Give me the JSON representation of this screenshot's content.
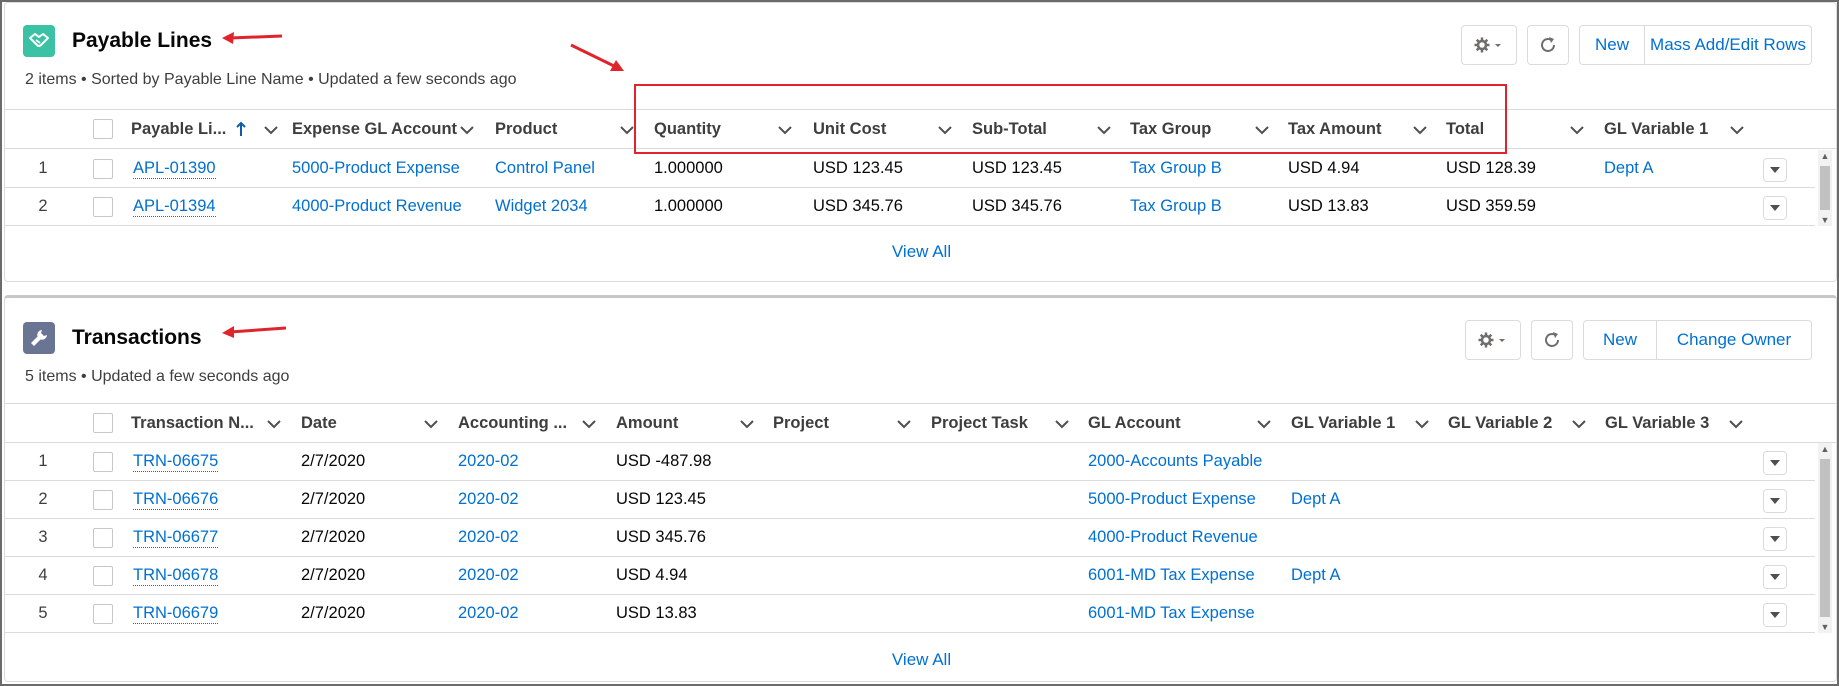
{
  "payable": {
    "title": "Payable Lines",
    "subtitle": "2 items • Sorted by Payable Line Name • Updated a few seconds ago",
    "buttons": {
      "new": "New",
      "mass": "Mass Add/Edit Rows"
    },
    "columns": [
      "Payable Li...",
      "Expense GL Account",
      "Product",
      "Quantity",
      "Unit Cost",
      "Sub-Total",
      "Tax Group",
      "Tax Amount",
      "Total",
      "GL Variable 1"
    ],
    "rows": [
      {
        "num": "1",
        "name": "APL-01390",
        "gl": "5000-Product Expense",
        "product": "Control Panel",
        "qty": "1.000000",
        "unit": "USD 123.45",
        "sub": "USD 123.45",
        "taxgroup": "Tax Group B",
        "taxamt": "USD 4.94",
        "total": "USD 128.39",
        "glv1": "Dept A"
      },
      {
        "num": "2",
        "name": "APL-01394",
        "gl": "4000-Product Revenue",
        "product": "Widget 2034",
        "qty": "1.000000",
        "unit": "USD 345.76",
        "sub": "USD 345.76",
        "taxgroup": "Tax Group B",
        "taxamt": "USD 13.83",
        "total": "USD 359.59",
        "glv1": ""
      }
    ],
    "view_all": "View All"
  },
  "transactions": {
    "title": "Transactions",
    "subtitle": "5 items • Updated a few seconds ago",
    "buttons": {
      "new": "New",
      "owner": "Change Owner"
    },
    "columns": [
      "Transaction N...",
      "Date",
      "Accounting ...",
      "Amount",
      "Project",
      "Project Task",
      "GL Account",
      "GL Variable 1",
      "GL Variable 2",
      "GL Variable 3"
    ],
    "rows": [
      {
        "num": "1",
        "name": "TRN-06675",
        "date": "2/7/2020",
        "period": "2020-02",
        "amount": "USD -487.98",
        "gl": "2000-Accounts Payable",
        "glv1": ""
      },
      {
        "num": "2",
        "name": "TRN-06676",
        "date": "2/7/2020",
        "period": "2020-02",
        "amount": "USD 123.45",
        "gl": "5000-Product Expense",
        "glv1": "Dept A"
      },
      {
        "num": "3",
        "name": "TRN-06677",
        "date": "2/7/2020",
        "period": "2020-02",
        "amount": "USD 345.76",
        "gl": "4000-Product Revenue",
        "glv1": ""
      },
      {
        "num": "4",
        "name": "TRN-06678",
        "date": "2/7/2020",
        "period": "2020-02",
        "amount": "USD 4.94",
        "gl": "6001-MD Tax Expense",
        "glv1": "Dept A"
      },
      {
        "num": "5",
        "name": "TRN-06679",
        "date": "2/7/2020",
        "period": "2020-02",
        "amount": "USD 13.83",
        "gl": "6001-MD Tax Expense",
        "glv1": ""
      }
    ],
    "view_all": "View All"
  },
  "colors": {
    "link": "#0070d2",
    "annotation": "#e0242c",
    "payable_icon": "#3bc1a3",
    "transactions_icon": "#6a7594"
  }
}
